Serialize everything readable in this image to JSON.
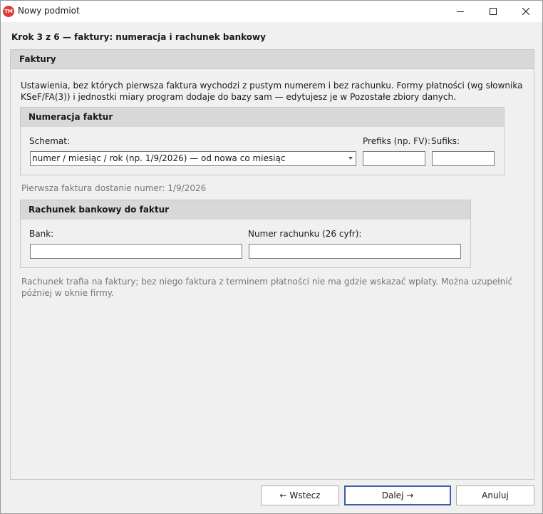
{
  "window": {
    "title": "Nowy podmiot",
    "app_icon_text": "TM"
  },
  "step": {
    "title": "Krok 3 z 6 — faktury: numeracja i rachunek bankowy"
  },
  "faktury": {
    "header": "Faktury",
    "intro": "Ustawienia, bez których pierwsza faktura wychodzi z pustym numerem i bez rachunku. Formy płatności (wg słownika KSeF/FA(3)) i jednostki miary program dodaje do bazy sam — edytujesz je w Pozostałe zbiory danych."
  },
  "numeracja": {
    "header": "Numeracja faktur",
    "schemat_label": "Schemat:",
    "schemat_value": "numer / miesiąc / rok (np. 1/9/2026) — od nowa co miesiąc",
    "prefiks_label": "Prefiks (np. FV):",
    "prefiks_value": "",
    "sufiks_label": "Sufiks:",
    "sufiks_value": "",
    "preview": "Pierwsza faktura dostanie numer: 1/9/2026"
  },
  "bank": {
    "header": "Rachunek bankowy do faktur",
    "bank_label": "Bank:",
    "bank_value": "",
    "account_label": "Numer rachunku (26 cyfr):",
    "account_value": "",
    "note": "Rachunek trafia na faktury; bez niego faktura z terminem płatności nie ma gdzie wskazać wpłaty. Można uzupełnić później w oknie firmy."
  },
  "buttons": {
    "back": "← Wstecz",
    "next": "Dalej →",
    "cancel": "Anuluj"
  },
  "colors": {
    "app_icon": "#e53935",
    "primary_border": "#3b5fa8",
    "header_bg": "#d8d8d8"
  }
}
